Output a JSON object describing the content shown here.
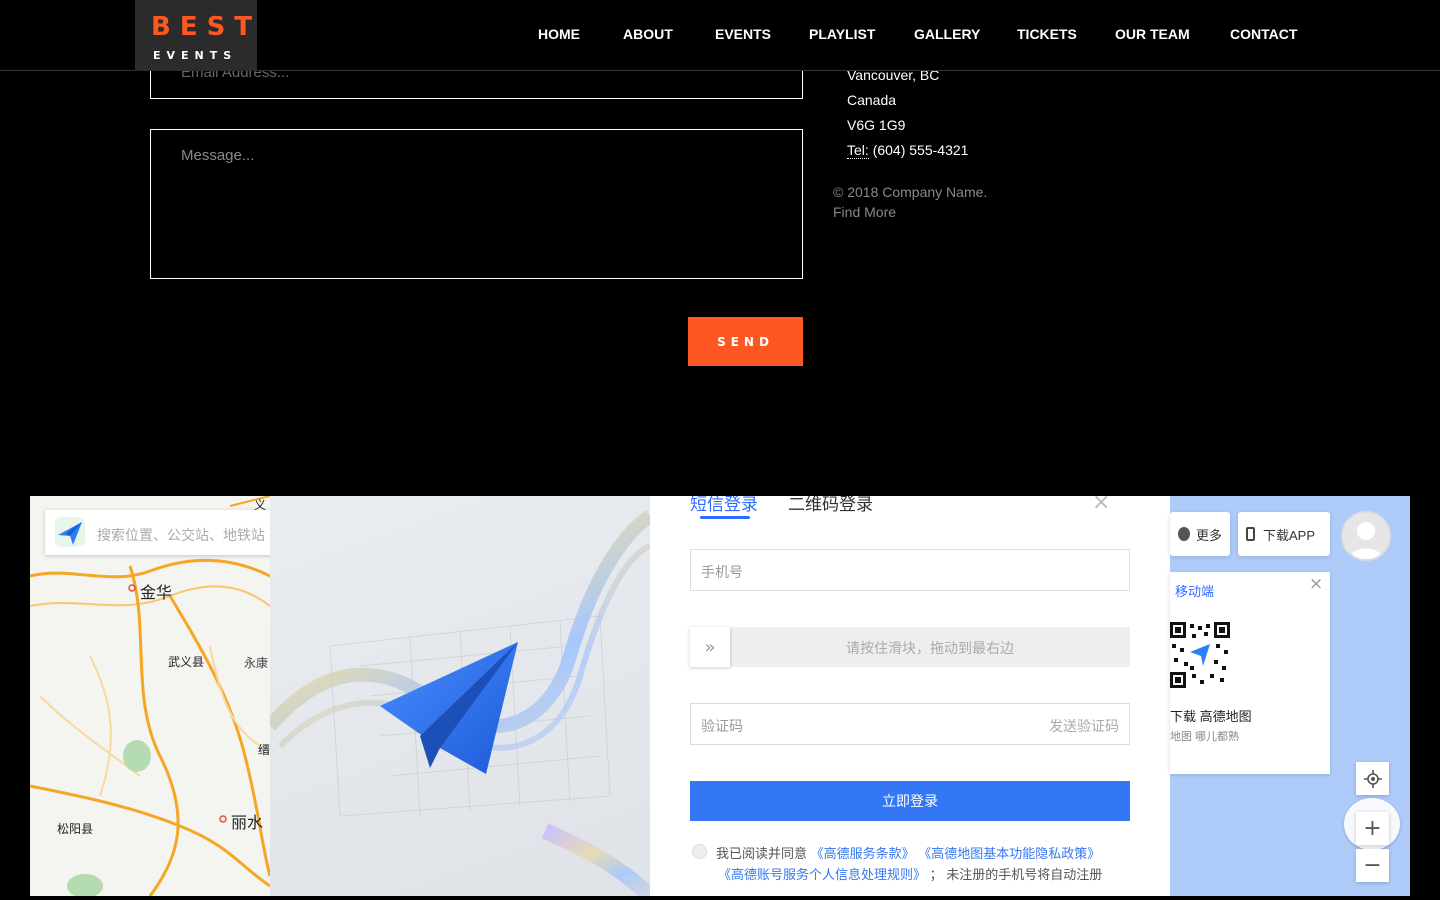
{
  "header": {
    "logo": {
      "line1": "BEST",
      "line2": "EVENTS"
    },
    "nav": [
      "HOME",
      "ABOUT",
      "EVENTS",
      "PLAYLIST",
      "GALLERY",
      "TICKETS",
      "OUR TEAM",
      "CONTACT"
    ]
  },
  "contact_form": {
    "email_placeholder": "Email Address...",
    "message_placeholder": "Message...",
    "send_label": "SEND"
  },
  "address": {
    "city": "Vancouver, BC",
    "country": "Canada",
    "postal": "V6G 1G9",
    "tel_label": "Tel:",
    "tel_value": "(604) 555-4321"
  },
  "footer": {
    "copyright": "© 2018 Company Name.",
    "find_more": "Find More"
  },
  "map": {
    "search_placeholder": "搜索位置、公交站、地铁站",
    "cities": [
      "金华",
      "武义县",
      "永康",
      "缙",
      "丽水",
      "松阳县",
      "义"
    ],
    "login": {
      "tab_sms": "短信登录",
      "tab_qr": "二维码登录",
      "phone_placeholder": "手机号",
      "slider_text": "请按住滑块，拖动到最右边",
      "code_placeholder": "验证码",
      "send_code": "发送验证码",
      "submit_label": "立即登录",
      "agree_prefix": "我已阅读并同意",
      "terms_service": "《高德服务条款》",
      "terms_privacy": "《高德地图基本功能隐私政策》",
      "terms_personal": "《高德账号服务个人信息处理规则》",
      "agree_suffix": "； 未注册的手机号将自动注册"
    },
    "right_panel": {
      "more_label": "更多",
      "download_app_label": "下载APP",
      "mobile_label": "移动端",
      "download_title": "下载 高德地图",
      "download_sub": "地图 哪儿都熟"
    },
    "controls": {
      "zoom_in": "+",
      "zoom_out": "−"
    }
  }
}
